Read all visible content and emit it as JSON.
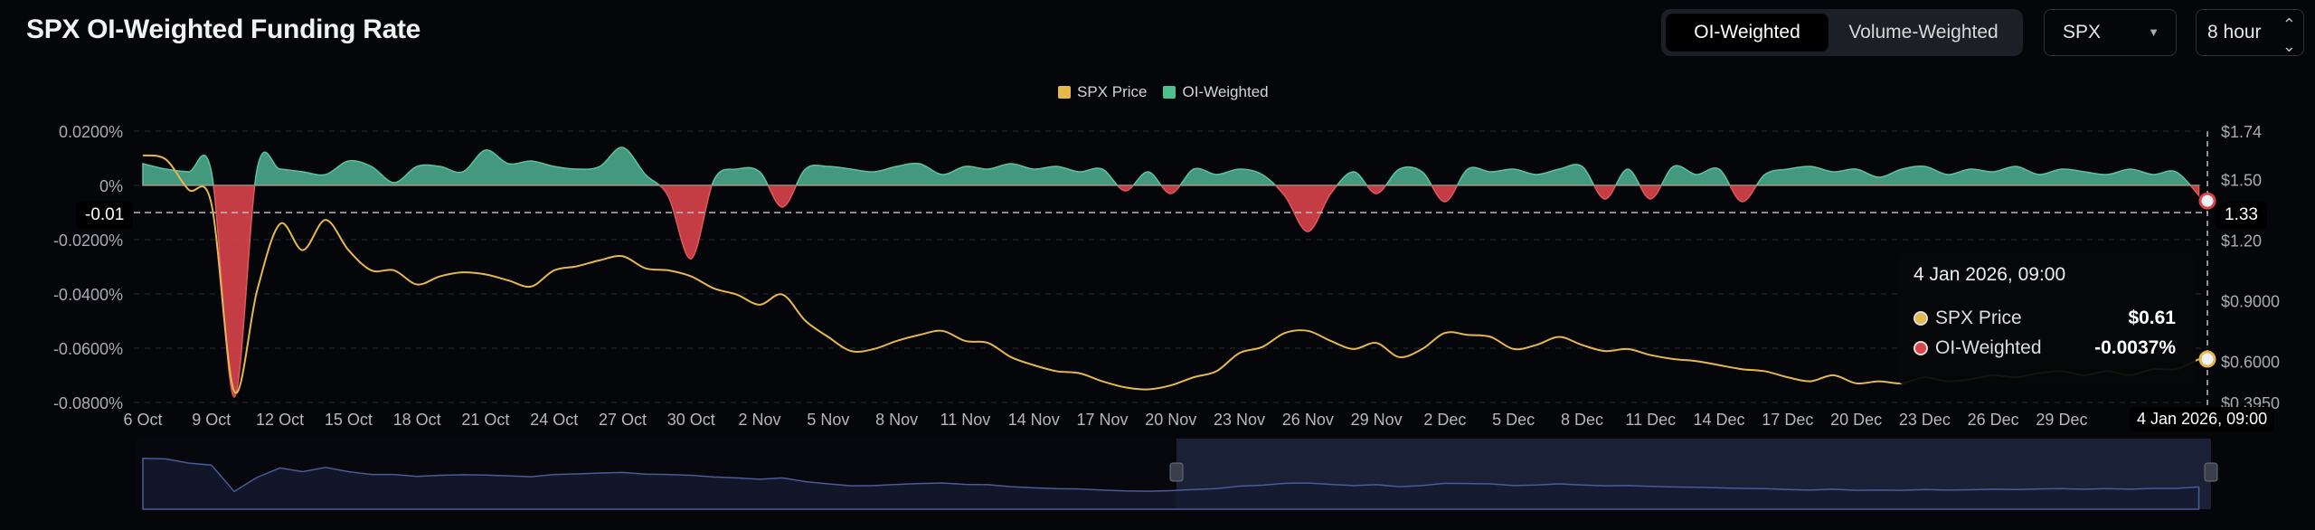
{
  "header": {
    "title": "SPX OI-Weighted Funding Rate",
    "toggle": {
      "options": [
        "OI-Weighted",
        "Volume-Weighted"
      ],
      "active": "OI-Weighted"
    },
    "asset_select": "SPX",
    "interval_select": "8 hour"
  },
  "colors": {
    "price": "#e5b84f",
    "positive": "#4aa98a",
    "negative": "#d9434a",
    "navigator": "#4a5a9a"
  },
  "tooltip": {
    "date": "4 Jan 2026, 09:00",
    "rows": [
      {
        "label": "SPX Price",
        "value": "$0.61",
        "color": "#e5b84f"
      },
      {
        "label": "OI-Weighted",
        "value": "-0.0037%",
        "color": "#d9434a"
      }
    ]
  },
  "crosshair": {
    "y_left_label": "-0.01",
    "y_right_label": "1.33",
    "x_label": "4 Jan 2026, 09:00"
  },
  "chart_data": {
    "type": "area",
    "title": "SPX OI-Weighted Funding Rate",
    "legend": [
      "SPX Price",
      "OI-Weighted"
    ],
    "legend_position": "top-center",
    "x_start": "6 Oct",
    "x_unit": "days",
    "x_end_offset": 90.375,
    "x_ticks": [
      "6 Oct",
      "9 Oct",
      "12 Oct",
      "15 Oct",
      "18 Oct",
      "21 Oct",
      "24 Oct",
      "27 Oct",
      "30 Oct",
      "2 Nov",
      "5 Nov",
      "8 Nov",
      "11 Nov",
      "14 Nov",
      "17 Nov",
      "20 Nov",
      "23 Nov",
      "26 Nov",
      "29 Nov",
      "2 Dec",
      "5 Dec",
      "8 Dec",
      "11 Dec",
      "14 Dec",
      "17 Dec",
      "20 Dec",
      "23 Dec",
      "26 Dec",
      "29 Dec"
    ],
    "y_left": {
      "ticks": [
        "0.0200%",
        "0%",
        "-0.0200%",
        "-0.0400%",
        "-0.0600%",
        "-0.0800%"
      ],
      "tick_values": [
        0.02,
        0,
        -0.02,
        -0.04,
        -0.06,
        -0.08
      ],
      "range": [
        -0.08,
        0.02
      ]
    },
    "y_right": {
      "ticks": [
        "$1.74",
        "$1.50",
        "$1.20",
        "$0.9000",
        "$0.6000",
        "$0.3950"
      ],
      "tick_values": [
        1.74,
        1.5,
        1.2,
        0.9,
        0.6,
        0.395
      ],
      "range": [
        0.395,
        1.74
      ]
    },
    "series": [
      {
        "name": "OI-Weighted",
        "unit": "%",
        "values": [
          0.008,
          0.006,
          0.005,
          0.005,
          -0.078,
          0.006,
          0.006,
          0.005,
          0.004,
          0.009,
          0.007,
          0.001,
          0.007,
          0.007,
          0.005,
          0.013,
          0.008,
          0.009,
          0.007,
          0.006,
          0.007,
          0.014,
          0.004,
          -0.004,
          -0.027,
          0.002,
          0.006,
          0.005,
          -0.008,
          0.006,
          0.007,
          0.006,
          0.005,
          0.007,
          0.008,
          0.004,
          0.007,
          0.006,
          0.008,
          0.006,
          0.007,
          0.005,
          0.006,
          -0.002,
          0.005,
          -0.003,
          0.006,
          0.004,
          0.006,
          0.004,
          -0.004,
          -0.017,
          -0.003,
          0.005,
          -0.003,
          0.006,
          0.005,
          -0.006,
          0.006,
          0.005,
          0.006,
          0.004,
          0.006,
          0.007,
          -0.005,
          0.006,
          -0.005,
          0.007,
          0.004,
          0.006,
          -0.006,
          0.004,
          0.006,
          0.007,
          0.005,
          0.006,
          0.003,
          0.006,
          0.007,
          0.004,
          0.006,
          0.005,
          0.007,
          0.004,
          0.006,
          0.005,
          0.004,
          0.006,
          0.004,
          0.005,
          -0.0037
        ]
      },
      {
        "name": "SPX Price",
        "unit": "$",
        "values": [
          1.62,
          1.6,
          1.45,
          1.38,
          0.45,
          0.95,
          1.28,
          1.15,
          1.3,
          1.15,
          1.05,
          1.05,
          0.98,
          1.02,
          1.04,
          1.03,
          1.0,
          0.97,
          1.05,
          1.07,
          1.1,
          1.12,
          1.06,
          1.05,
          1.02,
          0.96,
          0.93,
          0.88,
          0.93,
          0.8,
          0.72,
          0.65,
          0.66,
          0.7,
          0.73,
          0.75,
          0.7,
          0.69,
          0.62,
          0.58,
          0.55,
          0.54,
          0.5,
          0.47,
          0.46,
          0.48,
          0.52,
          0.55,
          0.64,
          0.67,
          0.74,
          0.75,
          0.7,
          0.66,
          0.69,
          0.62,
          0.66,
          0.74,
          0.73,
          0.72,
          0.66,
          0.68,
          0.72,
          0.68,
          0.65,
          0.66,
          0.63,
          0.61,
          0.6,
          0.58,
          0.56,
          0.55,
          0.52,
          0.5,
          0.53,
          0.49,
          0.5,
          0.49,
          0.52,
          0.5,
          0.51,
          0.53,
          0.52,
          0.54,
          0.55,
          0.53,
          0.55,
          0.53,
          0.56,
          0.56,
          0.61
        ]
      }
    ]
  }
}
